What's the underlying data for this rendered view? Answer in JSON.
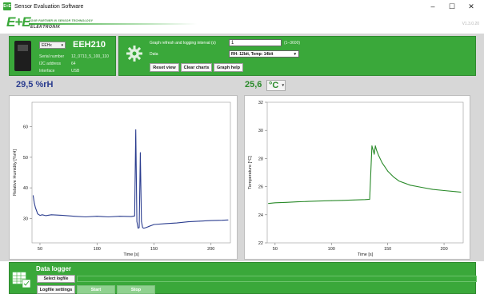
{
  "window": {
    "title": "Sensor Evaluation Software",
    "app_icon_text": "E+E",
    "minimize": "–",
    "maximize": "☐",
    "close": "✕"
  },
  "brand": {
    "logo": "E+E",
    "tagline": "YOUR PARTNER IN SENSOR TECHNOLOGY",
    "name": "ELEKTRONIK",
    "version": "V1.3.0.20"
  },
  "device": {
    "family_select": "EEHx",
    "name": "EEH210",
    "serial_label": "Serial number",
    "serial_value": "12_0713_5_100_110",
    "i2c_label": "I2C address",
    "i2c_value": "64",
    "interface_label": "Interface",
    "interface_value": "USB"
  },
  "settings": {
    "interval_label": "Graph refresh and logging interval (s)",
    "interval_value": "1",
    "interval_range": "(1–3600)",
    "data_label": "Data",
    "data_value": "RH: 12bit, Temp: 14bit",
    "reset_view": "Reset view",
    "clear_charts": "Clear charts",
    "graph_help": "Graph help"
  },
  "readings": {
    "rh": "29,5 %rH",
    "temp_value": "25,6",
    "temp_unit": "°C"
  },
  "colors": {
    "green": "#3aa83a",
    "rh_line": "#2b3d8f",
    "temp_line": "#2a8a2a"
  },
  "chart_data": [
    {
      "type": "line",
      "xlabel": "Time [s]",
      "ylabel": "Relative Humidity [%rH]",
      "xlim": [
        43,
        217
      ],
      "ylim": [
        22,
        68
      ],
      "xticks": [
        50,
        100,
        150,
        200
      ],
      "yticks": [
        30,
        40,
        50,
        60
      ],
      "grid": false,
      "series": [
        {
          "x": [
            44,
            45,
            46,
            47,
            48,
            50,
            52,
            55,
            60,
            70,
            80,
            90,
            100,
            110,
            120,
            130,
            133,
            134,
            135,
            136,
            137,
            138,
            139,
            140,
            141,
            143,
            145,
            150,
            160,
            170,
            180,
            190,
            200,
            210,
            215
          ],
          "y": [
            37.5,
            35,
            33.5,
            32.5,
            31.5,
            31,
            31.2,
            30.9,
            31.2,
            31,
            30.7,
            30.5,
            30.7,
            30.5,
            30.7,
            30.6,
            30.8,
            59,
            29,
            26.8,
            27,
            51.5,
            29,
            27,
            26.8,
            27,
            27.3,
            28,
            28.3,
            28.5,
            28.9,
            29.1,
            29.3,
            29.4,
            29.5
          ]
        }
      ]
    },
    {
      "type": "line",
      "xlabel": "Time [s]",
      "ylabel": "Temperature [°C]",
      "xlim": [
        43,
        217
      ],
      "ylim": [
        22,
        32
      ],
      "xticks": [
        50,
        100,
        150,
        200
      ],
      "yticks": [
        22,
        24,
        26,
        28,
        30,
        32
      ],
      "grid": false,
      "series": [
        {
          "x": [
            44,
            50,
            60,
            70,
            80,
            90,
            100,
            110,
            120,
            130,
            134,
            136,
            137,
            138,
            139,
            140,
            142,
            145,
            150,
            155,
            160,
            170,
            180,
            190,
            200,
            210,
            215
          ],
          "y": [
            24.8,
            24.85,
            24.88,
            24.92,
            24.95,
            24.98,
            25.0,
            25.02,
            25.05,
            25.08,
            25.1,
            28.9,
            28.6,
            28.3,
            28.9,
            28.6,
            28.2,
            27.7,
            27.1,
            26.7,
            26.4,
            26.1,
            25.95,
            25.8,
            25.72,
            25.65,
            25.6
          ]
        }
      ]
    }
  ],
  "logger": {
    "title": "Data logger",
    "select_logfile": "Select logfile",
    "logfile_settings": "Logfile settings",
    "start": "Start",
    "stop": "Stop"
  }
}
